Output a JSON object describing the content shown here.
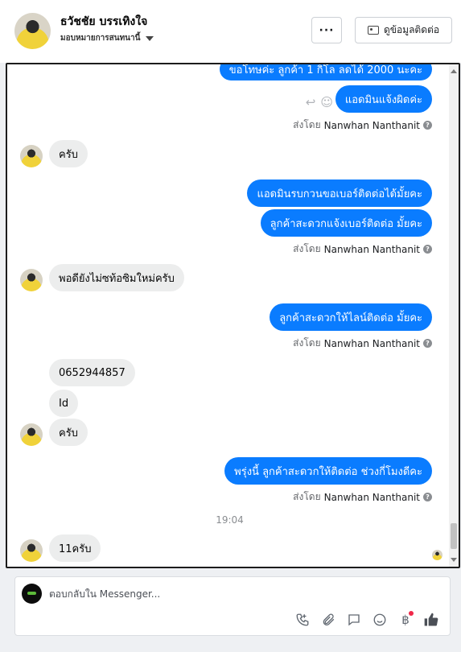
{
  "header": {
    "contact_name": "ธวัชชัย บรรเทิงใจ",
    "contact_subtitle": "มอบหมายการสนทนานี้",
    "more_button_label": "···",
    "view_contact_label": "ดูข้อมูลติดต่อ"
  },
  "thread": {
    "messages": [
      {
        "text": "ขอโทษค่ะ ลูกค้า  1 กิโล ลดได้ 2000 นะคะ"
      },
      {
        "text": "แอดมินแจ้งผิดค่ะ"
      },
      {
        "text": "ครับ"
      },
      {
        "text": "แอดมินรบกวนขอเบอร์ติดต่อได้มั้ยคะ"
      },
      {
        "text": "ลูกค้าสะดวกแจ้งเบอร์ติดต่อ มั้ยคะ"
      },
      {
        "text": "พอดียังไม่ซท้อซิมใหม่ครับ"
      },
      {
        "text": "ลูกค้าสะดวกให้ไลน์ติดต่อ มั้ยคะ"
      },
      {
        "text": "0652944857"
      },
      {
        "text": "Id"
      },
      {
        "text": "ครับ"
      },
      {
        "text": "พรุ่งนี้ ลูกค้าสะดวกให้ติดต่อ ช่วงกี่โมงดีคะ"
      },
      {
        "text": "11ครับ"
      }
    ],
    "sent_by_prefix": "ส่งโดย",
    "sent_by_name": "Nanwhan Nanthanit",
    "time_separator": "19:04"
  },
  "composer": {
    "placeholder": "ตอบกลับใน Messenger..."
  },
  "colors": {
    "outgoing_bubble": "#0a7cff",
    "incoming_bubble": "#eceded",
    "notification_dot": "#f02849"
  },
  "icons": [
    "more-icon",
    "contact-card-icon",
    "reply-icon",
    "emoji-react-icon",
    "help-icon",
    "call-icon",
    "attach-icon",
    "saved-reply-icon",
    "emoji-icon",
    "baht-icon",
    "like-icon"
  ]
}
